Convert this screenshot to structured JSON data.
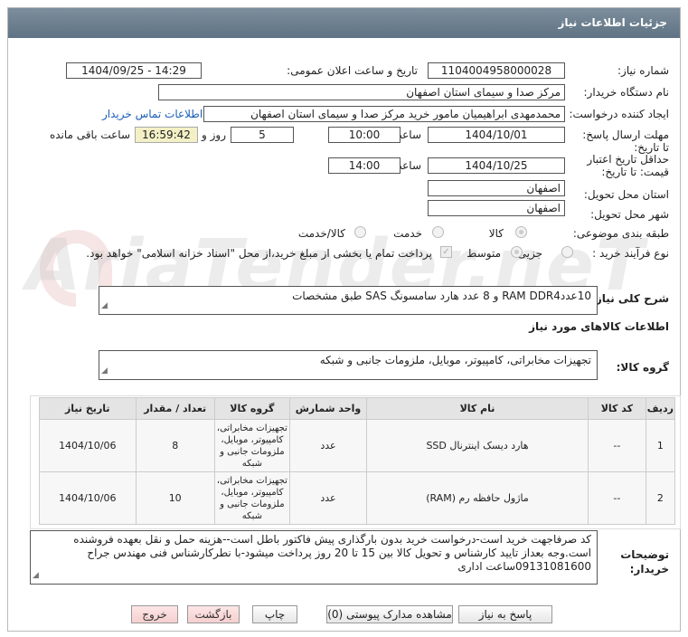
{
  "header": {
    "title": "جزئیات اطلاعات نیاز"
  },
  "form": {
    "need_number_label": "شماره نیاز:",
    "need_number": "1104004958000028",
    "announce_label": "تاریخ و ساعت اعلان عمومی:",
    "announce_value": "1404/09/25 - 14:29",
    "buyer_org_label": "نام دستگاه خریدار:",
    "buyer_org": "مرکز صدا و سیمای استان اصفهان",
    "creator_label": "ایجاد کننده درخواست:",
    "creator": "محمدمهدی ابراهیمیان مامور خرید مرکز صدا و سیمای استان اصفهان",
    "contact_link": "اطلاعات تماس خریدار",
    "deadline_label": "مهلت ارسال پاسخ: تا تاریخ:",
    "deadline_date": "1404/10/01",
    "time_label": "ساعت",
    "deadline_time": "10:00",
    "days_value": "5",
    "days_label": "روز و",
    "remaining_time": "16:59:42",
    "remaining_label": "ساعت باقی مانده",
    "validity_label": "حداقل تاریخ اعتبار قیمت: تا تاریخ:",
    "validity_date": "1404/10/25",
    "validity_time_label": "ساعت",
    "validity_time": "14:00",
    "province_label": "استان محل تحویل:",
    "province": "اصفهان",
    "city_label": "شهر محل تحویل:",
    "city": "اصفهان",
    "category_label": "طبقه بندی موضوعی:",
    "category_options": [
      "کالا",
      "خدمت",
      "کالا/خدمت"
    ],
    "process_label": "نوع فرآیند خرید :",
    "process_options": [
      "جزیی",
      "متوسط"
    ],
    "payment_note": "پرداخت تمام یا بخشی از مبلغ خرید،از محل \"اسناد خزانه اسلامی\" خواهد بود.",
    "summary_label": "شرح کلی نیاز:",
    "summary": "10عددRAM DDR4  و 8 عدد هارد سامسونگ SAS  طبق مشخصات",
    "goods_info_title": "اطلاعات کالاهای مورد نیاز",
    "goods_group_label": "گروه کالا:",
    "goods_group": "تجهیزات مخابراتی، کامپیوتر، موبایل، ملزومات جانبی و شبکه"
  },
  "table": {
    "headers": [
      "ردیف",
      "کد کالا",
      "نام کالا",
      "واحد شمارش",
      "گروه کالا",
      "تعداد / مقدار",
      "تاریخ نیاز"
    ],
    "rows": [
      {
        "row": "1",
        "code": "--",
        "name": "هارد دیسک اینترنال SSD",
        "unit": "عدد",
        "group": "تجهیزات مخابراتی، کامپیوتر، موبایل، ملزومات جانبی و شبکه",
        "qty": "8",
        "date": "1404/10/06"
      },
      {
        "row": "2",
        "code": "--",
        "name": "ماژول حافظه رم (RAM)",
        "unit": "عدد",
        "group": "تجهیزات مخابراتی، کامپیوتر، موبایل، ملزومات جانبی و شبکه",
        "qty": "10",
        "date": "1404/10/06"
      }
    ]
  },
  "notes": {
    "label": "توضیحات خریدار:",
    "text": "کد صرفاجهت خرید است-درخواست خرید بدون  بارگذاری پیش فاکتور باطل است--هزینه حمل و نقل بعهده فروشنده است.وجه بعداز تایید  کارشناس و تحویل کالا بین 15 تا 20 روز پرداخت میشود-با نطرکارشناس فنی مهندس جراح 09131081600ساعت اداری"
  },
  "buttons": {
    "reply": "پاسخ به نیاز",
    "view_docs": "مشاهده مدارک پیوستی (0)",
    "print": "چاپ",
    "back": "بازگشت",
    "exit": "خروج"
  },
  "watermark": "AriaTender.neT",
  "colors": {
    "titlebar": "#6b7d8c",
    "link": "#1a5fb4",
    "highlight": "#f4f0c6",
    "exit_button": "#f6cfcf"
  }
}
